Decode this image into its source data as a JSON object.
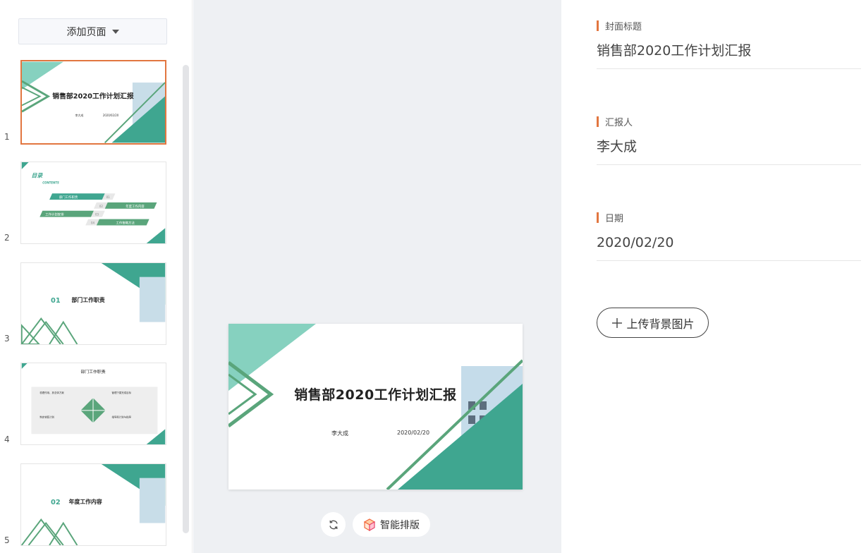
{
  "left_panel": {
    "add_page_label": "添加页面",
    "thumbnails": [
      {
        "number": "1",
        "title": "销售部2020工作计划汇报",
        "reporter": "李大成",
        "date": "2020/02/20"
      },
      {
        "number": "2",
        "title": "目录",
        "subtitle": "CONTENTS",
        "items": [
          "部门工作职责",
          "年度工作内容",
          "工作计划安排",
          "工作策略方法"
        ],
        "item_numbers": [
          "01",
          "02",
          "03",
          "04"
        ]
      },
      {
        "number": "3",
        "section_number": "01",
        "section_title": "部门工作职责"
      },
      {
        "number": "4",
        "title": "部门工作职责",
        "cards": [
          "梳理作用、其总体方案",
          "管理下属完成目标",
          "制定销售计划",
          "指导和计划与指导"
        ]
      },
      {
        "number": "5",
        "section_number": "02",
        "section_title": "年度工作内容"
      }
    ]
  },
  "canvas": {
    "title": "销售部2020工作计划汇报",
    "reporter": "李大成",
    "date": "2020/02/20",
    "smart_layout_label": "智能排版"
  },
  "form": {
    "fields": [
      {
        "label": "封面标题",
        "value": "销售部2020工作计划汇报"
      },
      {
        "label": "汇报人",
        "value": "李大成"
      },
      {
        "label": "日期",
        "value": "2020/02/20"
      }
    ],
    "upload_label": "上传背景图片"
  },
  "colors": {
    "accent": "#e27640",
    "teal": "#3fa690",
    "teal_light": "#86d1bf",
    "green_stripe": "#5aa57b"
  },
  "icons": {
    "refresh": "refresh-icon",
    "smart_layout": "cube-icon",
    "dropdown": "caret-down-icon",
    "upload": "plus-icon"
  }
}
